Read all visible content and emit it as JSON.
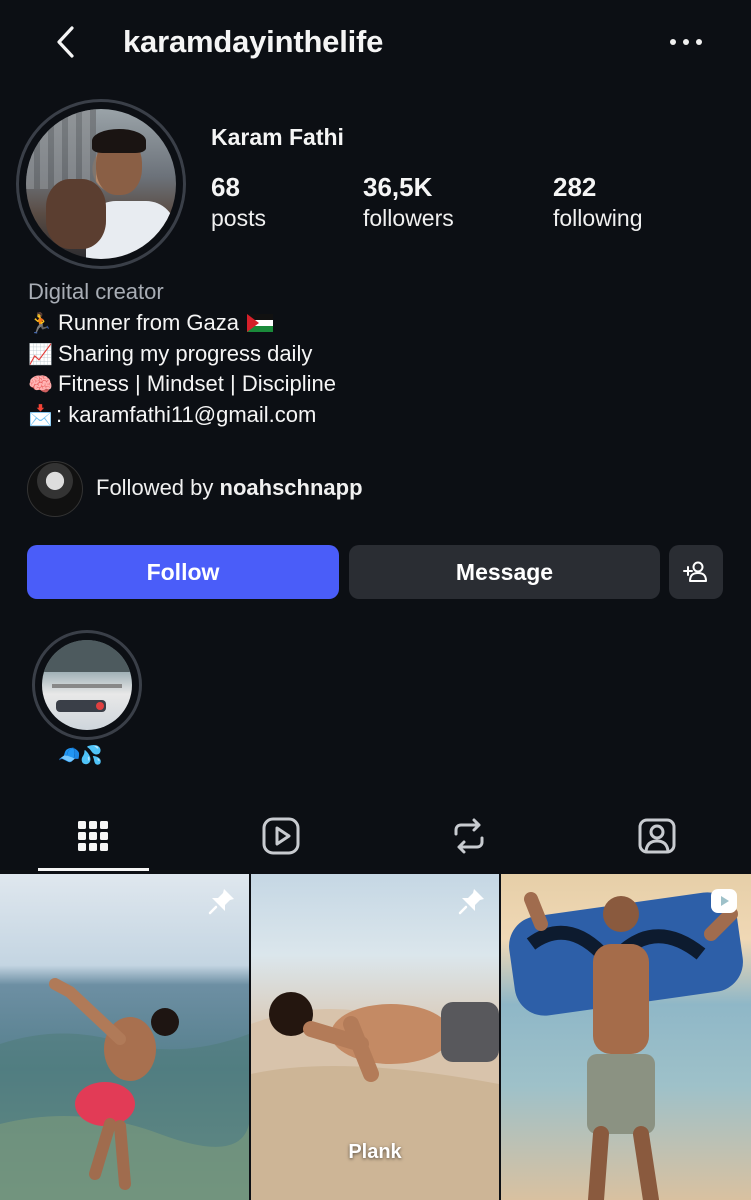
{
  "header": {
    "username": "karamdayinthelife"
  },
  "profile": {
    "full_name": "Karam Fathi",
    "stats": [
      {
        "value": "68",
        "label": "posts"
      },
      {
        "value": "36,5K",
        "label": "followers"
      },
      {
        "value": "282",
        "label": "following"
      }
    ],
    "category": "Digital creator",
    "bio": [
      {
        "emoji": "🏃",
        "text": "Runner from Gaza"
      },
      {
        "emoji": "📈",
        "text": "Sharing my progress daily"
      },
      {
        "emoji": "🧠",
        "text": "Fitness | Mindset | Discipline"
      },
      {
        "emoji": "📩",
        "text": ": karamfathi11@gmail.com"
      }
    ],
    "followed_by_prefix": "Followed by ",
    "followed_by_user": "noahschnapp"
  },
  "actions": {
    "follow": "Follow",
    "message": "Message"
  },
  "highlight": {
    "label": "🧢💦"
  },
  "tabs": [
    "grid-icon",
    "reels-icon",
    "reposts-icon",
    "tagged-icon"
  ],
  "posts": [
    {
      "type": "pinned",
      "caption": ""
    },
    {
      "type": "pinned",
      "caption": "Plank"
    },
    {
      "type": "reel",
      "caption": ""
    }
  ]
}
